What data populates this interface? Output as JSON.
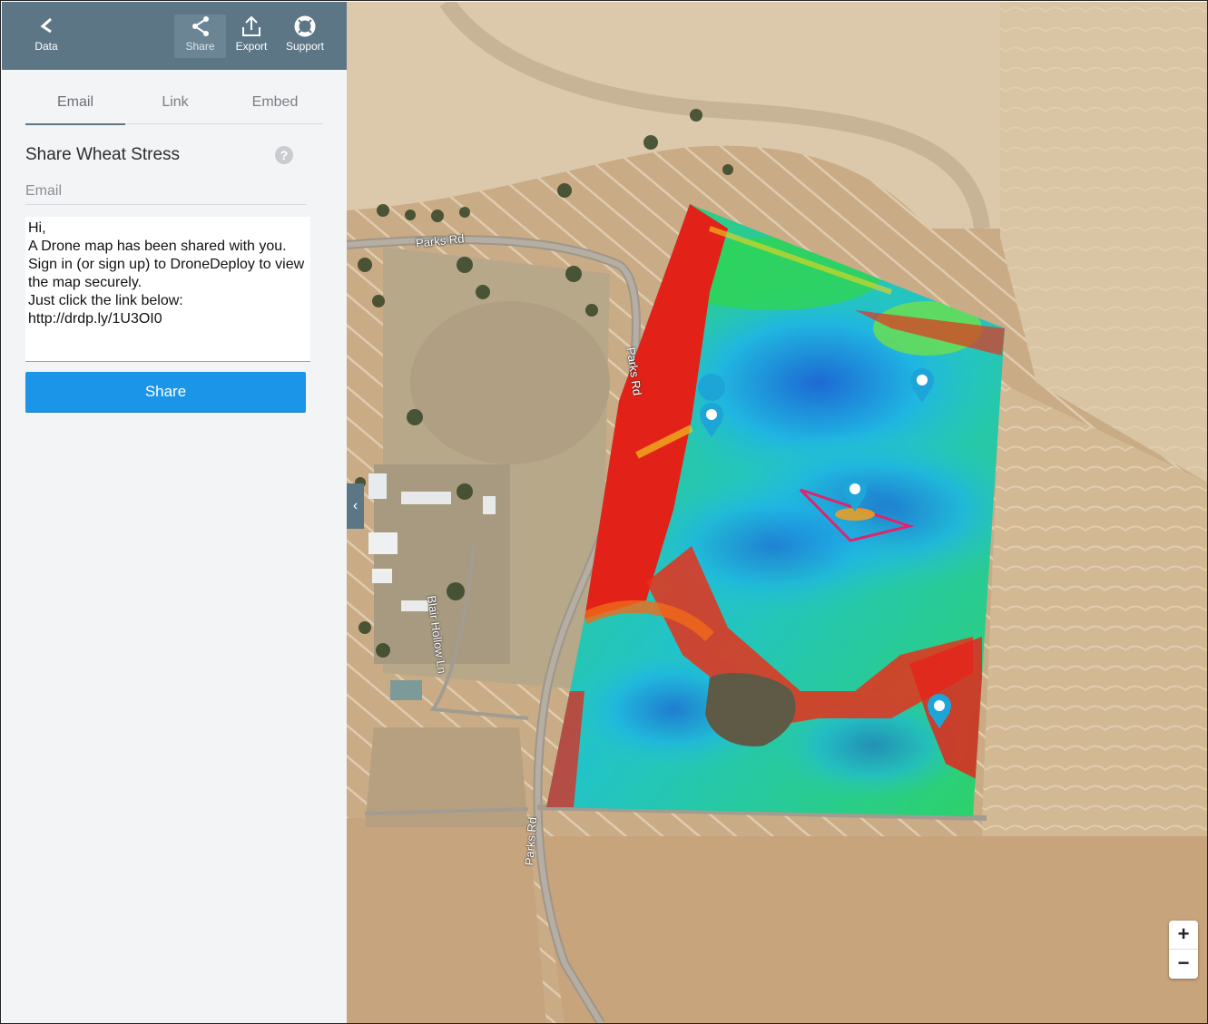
{
  "toolbar": {
    "back_label": "Data",
    "share_label": "Share",
    "export_label": "Export",
    "support_label": "Support"
  },
  "tabs": [
    {
      "label": "Email",
      "active": true
    },
    {
      "label": "Link",
      "active": false
    },
    {
      "label": "Embed",
      "active": false
    }
  ],
  "share": {
    "title": "Share Wheat Stress",
    "email_placeholder": "Email",
    "message_lines": [
      "Hi,",
      "A Drone map has been shared with you.",
      "Sign in (or sign up) to DroneDeploy to view",
      "the map securely.",
      "Just click the link below:",
      "http://drdp.ly/1U3OI0"
    ],
    "button_label": "Share"
  },
  "map": {
    "road_labels": [
      "Parks Rd",
      "Parks Rd",
      "Blair Hollow Ln",
      "Parks Rd"
    ],
    "zoom_in": "+",
    "zoom_out": "−",
    "collapse": "‹"
  },
  "colors": {
    "toolbar_bg": "#5d7686",
    "accent": "#1b95e8",
    "annotation": "#e0236e",
    "marker": "#1ea5d8"
  }
}
